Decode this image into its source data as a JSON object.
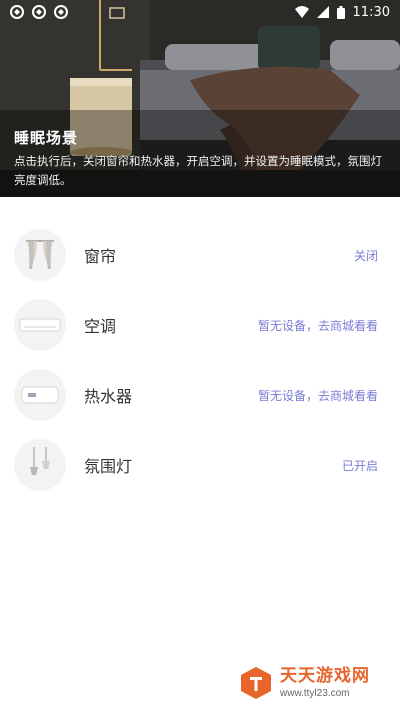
{
  "status_bar": {
    "time": "11:30",
    "notification_icons": [
      "notification-icon",
      "notification-icon",
      "notification-icon"
    ],
    "system_icons": [
      "wifi-icon",
      "signal-icon",
      "battery-icon"
    ]
  },
  "scene": {
    "title": "睡眠场景",
    "description": "点击执行后，关闭窗帘和热水器，开启空调，并设置为睡眠模式，氛围灯亮度调低。"
  },
  "devices": [
    {
      "name": "窗帘",
      "status": "关闭",
      "icon": "curtain-icon"
    },
    {
      "name": "空调",
      "status": "暂无设备，去商城看看",
      "icon": "air-conditioner-icon"
    },
    {
      "name": "热水器",
      "status": "暂无设备，去商城看看",
      "icon": "water-heater-icon"
    },
    {
      "name": "氛围灯",
      "status": "已开启",
      "icon": "ambient-light-icon"
    }
  ],
  "colors": {
    "status_accent": "#7a7ed6",
    "watermark": "#e8642b"
  },
  "watermark": {
    "title": "天天游戏网",
    "url": "www.ttyl23.com"
  }
}
